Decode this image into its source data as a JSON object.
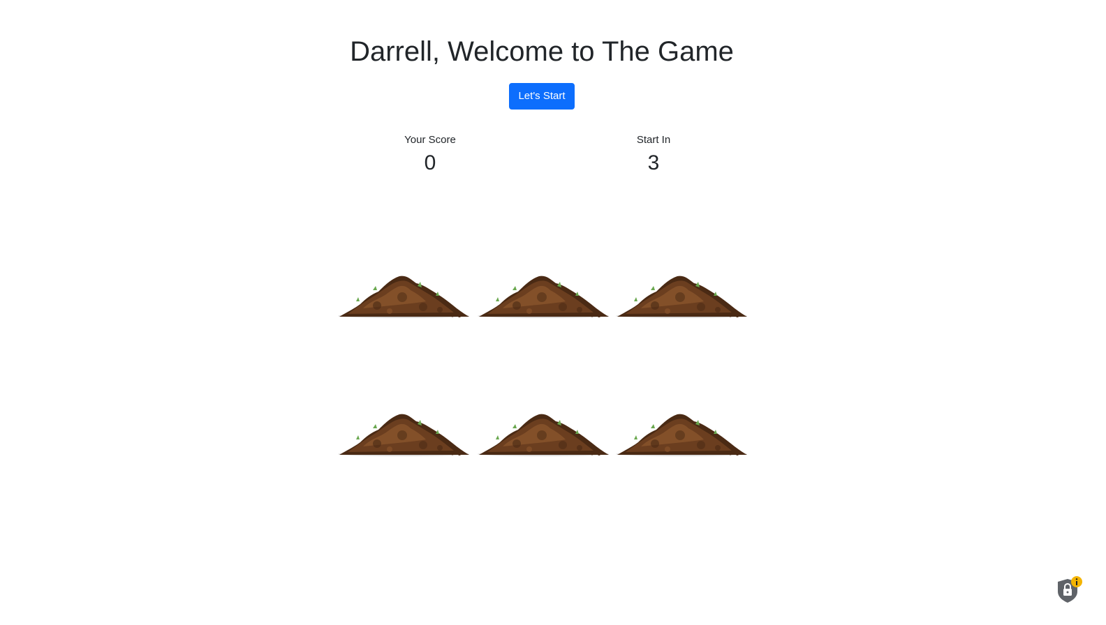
{
  "header": {
    "title": "Darrell, Welcome to The Game",
    "start_button": "Let's Start"
  },
  "stats": {
    "score_label": "Your Score",
    "score_value": "0",
    "start_label": "Start In",
    "start_value": "3"
  },
  "board": {
    "holes": [
      {
        "icon": "dirt-mound-icon"
      },
      {
        "icon": "dirt-mound-icon"
      },
      {
        "icon": "dirt-mound-icon"
      },
      {
        "icon": "dirt-mound-icon"
      },
      {
        "icon": "dirt-mound-icon"
      },
      {
        "icon": "dirt-mound-icon"
      }
    ]
  },
  "colors": {
    "accent": "#0d6efd",
    "dirt_dark": "#4a2a14",
    "dirt_mid": "#6b3e1f",
    "dirt_light": "#8a552c",
    "grass": "#6aa84f"
  },
  "extension": {
    "icon": "shield-lock-icon",
    "badge_icon": "info-icon"
  }
}
